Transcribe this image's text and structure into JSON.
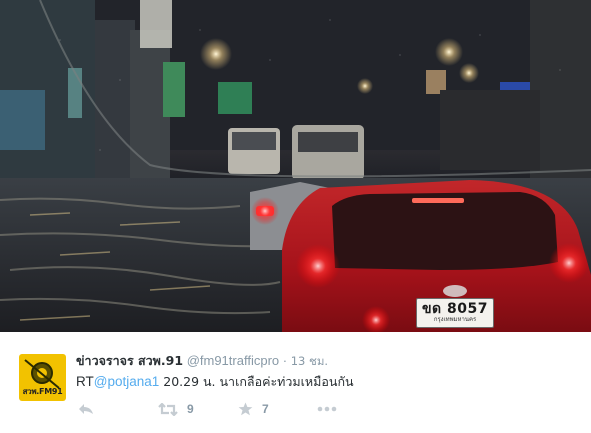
{
  "photo": {
    "plate_number": "ขด 8057",
    "plate_province": "กรุงเทพมหานคร"
  },
  "tweet": {
    "display_name": "ข่าวจราจร สวพ.91",
    "handle": "@fm91trafficpro",
    "separator": "·",
    "timestamp": "13 ชม.",
    "avatar_label": "สวพ.FM91",
    "text_prefix": "RT",
    "mention": "@potjana1",
    "text_body": " 20.29 น.  นาเกลือค่ะท่วมเหมือนกัน",
    "retweet_count": "9",
    "favorite_count": "7"
  },
  "icons": {
    "reply": "reply-arrow-icon",
    "retweet": "retweet-icon",
    "favorite": "star-icon",
    "more": "ellipsis-icon"
  },
  "colors": {
    "link": "#55acee",
    "muted": "#8899a6",
    "text": "#292f33",
    "avatar_bg": "#f2c200"
  }
}
